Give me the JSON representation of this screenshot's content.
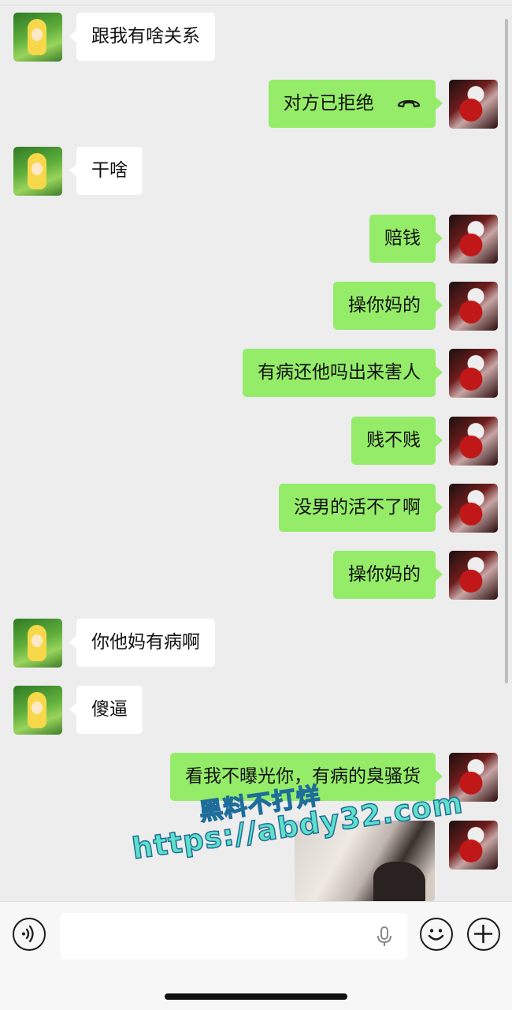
{
  "chat": {
    "messages": [
      {
        "side": "left",
        "text": "跟我有啥关系"
      },
      {
        "side": "right",
        "text": "对方已拒绝",
        "icon": "hangup-icon"
      },
      {
        "side": "left",
        "text": "干啥"
      },
      {
        "side": "right",
        "text": "赔钱"
      },
      {
        "side": "right",
        "text": "操你妈的"
      },
      {
        "side": "right",
        "text": "有病还他吗出来害人"
      },
      {
        "side": "right",
        "text": "贱不贱"
      },
      {
        "side": "right",
        "text": "没男的活不了啊"
      },
      {
        "side": "right",
        "text": "操你妈的"
      },
      {
        "side": "left",
        "text": "你他妈有病啊"
      },
      {
        "side": "left",
        "text": "傻逼"
      },
      {
        "side": "right",
        "text": "看我不曝光你，有病的臭骚货"
      }
    ],
    "last_message": {
      "side": "right",
      "type": "image"
    }
  },
  "watermark": {
    "line1": "黑料不打烊",
    "line2": "https://abdy32.com"
  },
  "input_bar": {
    "voice_icon": "voice-mode-icon",
    "mic_icon": "microphone-icon",
    "emoji_icon": "emoji-icon",
    "plus_icon": "plus-icon"
  },
  "colors": {
    "background": "#ededed",
    "sent_bubble": "#95ec69",
    "received_bubble": "#ffffff"
  }
}
